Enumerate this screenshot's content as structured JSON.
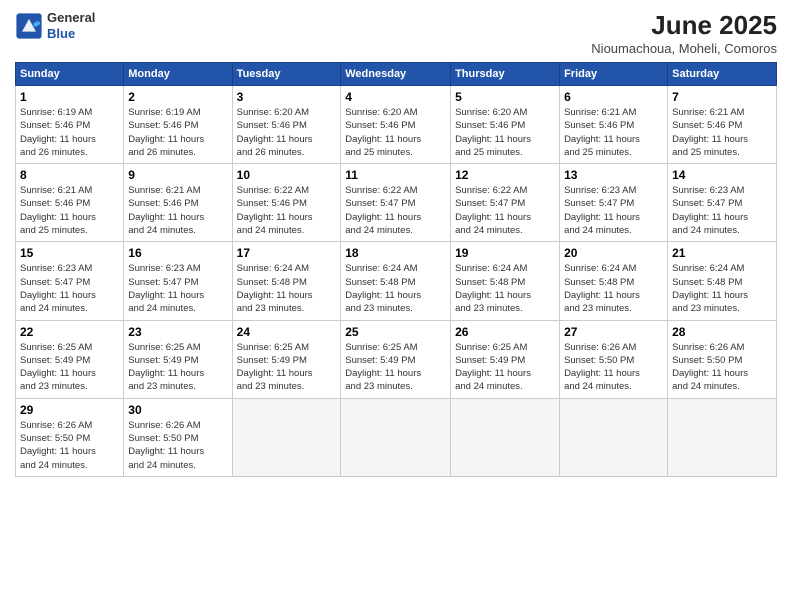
{
  "header": {
    "logo_general": "General",
    "logo_blue": "Blue",
    "title": "June 2025",
    "subtitle": "Nioumachoua, Moheli, Comoros"
  },
  "weekdays": [
    "Sunday",
    "Monday",
    "Tuesday",
    "Wednesday",
    "Thursday",
    "Friday",
    "Saturday"
  ],
  "weeks": [
    [
      {
        "day": "1",
        "info": "Sunrise: 6:19 AM\nSunset: 5:46 PM\nDaylight: 11 hours\nand 26 minutes."
      },
      {
        "day": "2",
        "info": "Sunrise: 6:19 AM\nSunset: 5:46 PM\nDaylight: 11 hours\nand 26 minutes."
      },
      {
        "day": "3",
        "info": "Sunrise: 6:20 AM\nSunset: 5:46 PM\nDaylight: 11 hours\nand 26 minutes."
      },
      {
        "day": "4",
        "info": "Sunrise: 6:20 AM\nSunset: 5:46 PM\nDaylight: 11 hours\nand 25 minutes."
      },
      {
        "day": "5",
        "info": "Sunrise: 6:20 AM\nSunset: 5:46 PM\nDaylight: 11 hours\nand 25 minutes."
      },
      {
        "day": "6",
        "info": "Sunrise: 6:21 AM\nSunset: 5:46 PM\nDaylight: 11 hours\nand 25 minutes."
      },
      {
        "day": "7",
        "info": "Sunrise: 6:21 AM\nSunset: 5:46 PM\nDaylight: 11 hours\nand 25 minutes."
      }
    ],
    [
      {
        "day": "8",
        "info": "Sunrise: 6:21 AM\nSunset: 5:46 PM\nDaylight: 11 hours\nand 25 minutes."
      },
      {
        "day": "9",
        "info": "Sunrise: 6:21 AM\nSunset: 5:46 PM\nDaylight: 11 hours\nand 24 minutes."
      },
      {
        "day": "10",
        "info": "Sunrise: 6:22 AM\nSunset: 5:46 PM\nDaylight: 11 hours\nand 24 minutes."
      },
      {
        "day": "11",
        "info": "Sunrise: 6:22 AM\nSunset: 5:47 PM\nDaylight: 11 hours\nand 24 minutes."
      },
      {
        "day": "12",
        "info": "Sunrise: 6:22 AM\nSunset: 5:47 PM\nDaylight: 11 hours\nand 24 minutes."
      },
      {
        "day": "13",
        "info": "Sunrise: 6:23 AM\nSunset: 5:47 PM\nDaylight: 11 hours\nand 24 minutes."
      },
      {
        "day": "14",
        "info": "Sunrise: 6:23 AM\nSunset: 5:47 PM\nDaylight: 11 hours\nand 24 minutes."
      }
    ],
    [
      {
        "day": "15",
        "info": "Sunrise: 6:23 AM\nSunset: 5:47 PM\nDaylight: 11 hours\nand 24 minutes."
      },
      {
        "day": "16",
        "info": "Sunrise: 6:23 AM\nSunset: 5:47 PM\nDaylight: 11 hours\nand 24 minutes."
      },
      {
        "day": "17",
        "info": "Sunrise: 6:24 AM\nSunset: 5:48 PM\nDaylight: 11 hours\nand 23 minutes."
      },
      {
        "day": "18",
        "info": "Sunrise: 6:24 AM\nSunset: 5:48 PM\nDaylight: 11 hours\nand 23 minutes."
      },
      {
        "day": "19",
        "info": "Sunrise: 6:24 AM\nSunset: 5:48 PM\nDaylight: 11 hours\nand 23 minutes."
      },
      {
        "day": "20",
        "info": "Sunrise: 6:24 AM\nSunset: 5:48 PM\nDaylight: 11 hours\nand 23 minutes."
      },
      {
        "day": "21",
        "info": "Sunrise: 6:24 AM\nSunset: 5:48 PM\nDaylight: 11 hours\nand 23 minutes."
      }
    ],
    [
      {
        "day": "22",
        "info": "Sunrise: 6:25 AM\nSunset: 5:49 PM\nDaylight: 11 hours\nand 23 minutes."
      },
      {
        "day": "23",
        "info": "Sunrise: 6:25 AM\nSunset: 5:49 PM\nDaylight: 11 hours\nand 23 minutes."
      },
      {
        "day": "24",
        "info": "Sunrise: 6:25 AM\nSunset: 5:49 PM\nDaylight: 11 hours\nand 23 minutes."
      },
      {
        "day": "25",
        "info": "Sunrise: 6:25 AM\nSunset: 5:49 PM\nDaylight: 11 hours\nand 23 minutes."
      },
      {
        "day": "26",
        "info": "Sunrise: 6:25 AM\nSunset: 5:49 PM\nDaylight: 11 hours\nand 24 minutes."
      },
      {
        "day": "27",
        "info": "Sunrise: 6:26 AM\nSunset: 5:50 PM\nDaylight: 11 hours\nand 24 minutes."
      },
      {
        "day": "28",
        "info": "Sunrise: 6:26 AM\nSunset: 5:50 PM\nDaylight: 11 hours\nand 24 minutes."
      }
    ],
    [
      {
        "day": "29",
        "info": "Sunrise: 6:26 AM\nSunset: 5:50 PM\nDaylight: 11 hours\nand 24 minutes."
      },
      {
        "day": "30",
        "info": "Sunrise: 6:26 AM\nSunset: 5:50 PM\nDaylight: 11 hours\nand 24 minutes."
      },
      {
        "day": "",
        "info": ""
      },
      {
        "day": "",
        "info": ""
      },
      {
        "day": "",
        "info": ""
      },
      {
        "day": "",
        "info": ""
      },
      {
        "day": "",
        "info": ""
      }
    ]
  ]
}
